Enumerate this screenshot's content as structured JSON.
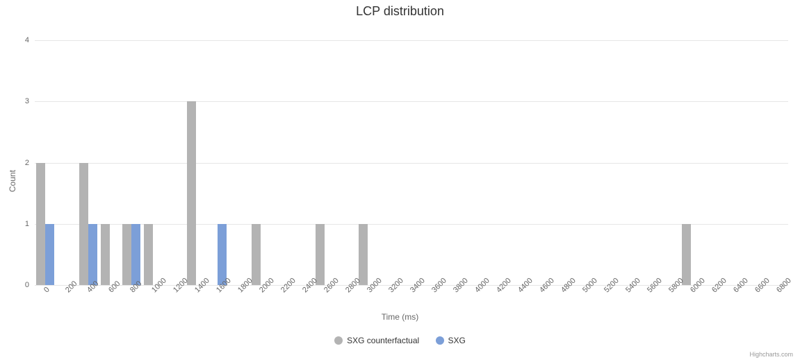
{
  "chart_data": {
    "type": "bar",
    "title": "LCP distribution",
    "xlabel": "Time (ms)",
    "ylabel": "Count",
    "ylim": [
      0,
      4
    ],
    "yticks": [
      0,
      1,
      2,
      3,
      4
    ],
    "categories": [
      0,
      200,
      400,
      600,
      800,
      1000,
      1200,
      1400,
      1600,
      1800,
      2000,
      2200,
      2400,
      2600,
      2800,
      3000,
      3200,
      3400,
      3600,
      3800,
      4000,
      4200,
      4400,
      4600,
      4800,
      5000,
      5200,
      5400,
      5600,
      5800,
      6000,
      6200,
      6400,
      6600,
      6800
    ],
    "series": [
      {
        "name": "SXG counterfactual",
        "color": "#b3b3b3",
        "values": [
          2,
          0,
          2,
          1,
          1,
          1,
          0,
          3,
          0,
          0,
          1,
          0,
          0,
          1,
          0,
          1,
          0,
          0,
          0,
          0,
          0,
          0,
          0,
          0,
          0,
          0,
          0,
          0,
          0,
          0,
          1,
          0,
          0,
          0,
          0
        ]
      },
      {
        "name": "SXG",
        "color": "#7c9fd8",
        "values": [
          1,
          0,
          1,
          0,
          1,
          0,
          0,
          0,
          1,
          0,
          0,
          0,
          0,
          0,
          0,
          0,
          0,
          0,
          0,
          0,
          0,
          0,
          0,
          0,
          0,
          0,
          0,
          0,
          0,
          0,
          0,
          0,
          0,
          0,
          0
        ]
      }
    ],
    "credit": "Highcharts.com"
  }
}
